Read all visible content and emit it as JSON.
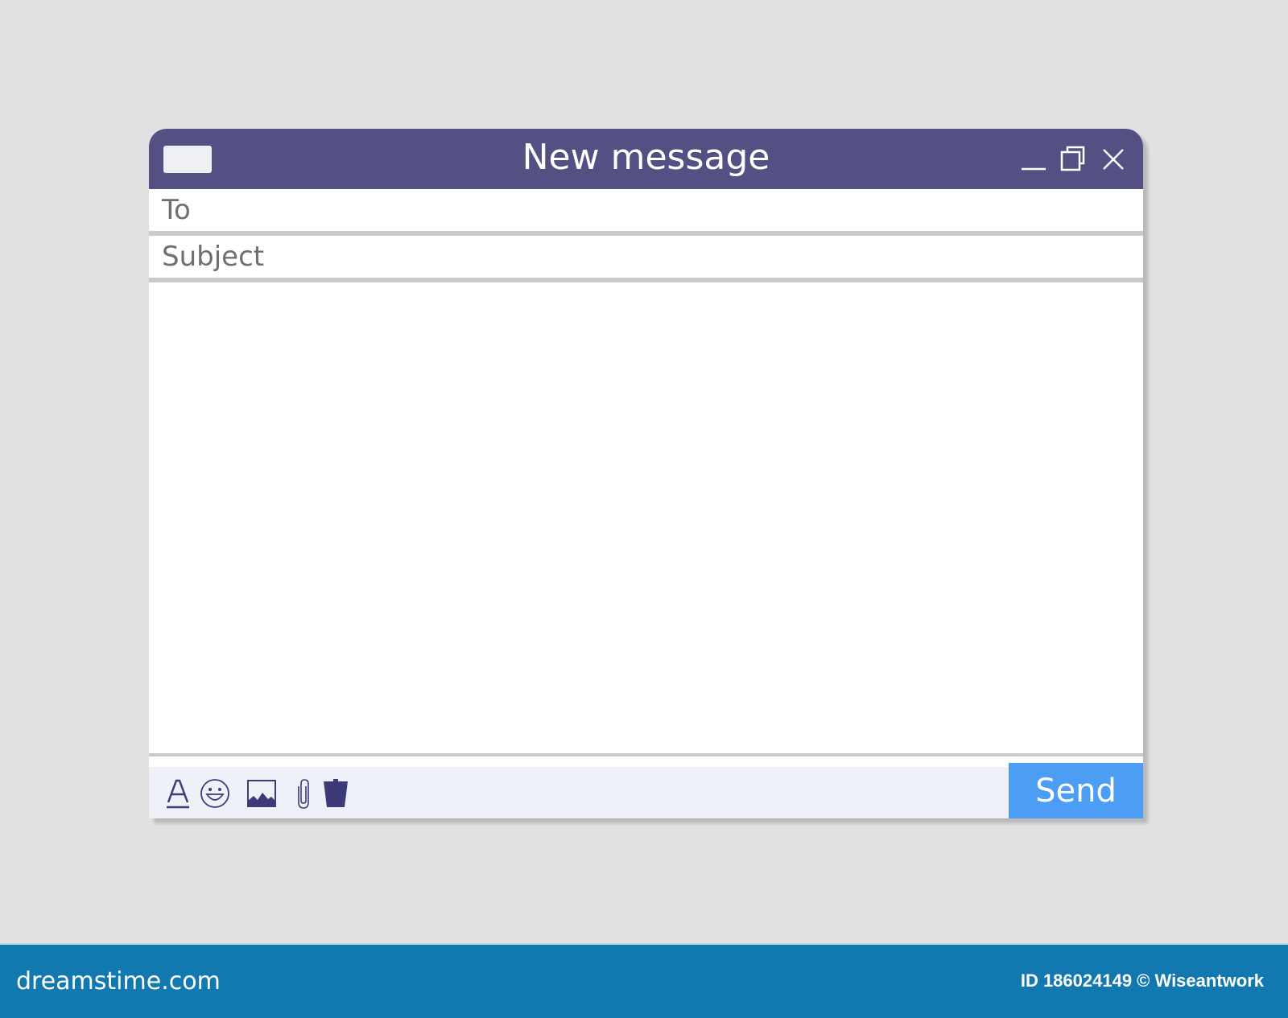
{
  "window": {
    "title": "New message",
    "icons": {
      "app": "envelope-icon",
      "minimize": "minimize-icon",
      "maximize": "restore-icon",
      "close": "close-icon"
    }
  },
  "compose": {
    "to": {
      "placeholder": "To",
      "value": ""
    },
    "subject": {
      "placeholder": "Subject",
      "value": ""
    },
    "body": {
      "value": ""
    }
  },
  "toolbar": {
    "tools": [
      {
        "name": "format-text",
        "icon": "text-format-icon"
      },
      {
        "name": "emoji",
        "icon": "smiley-icon"
      },
      {
        "name": "insert-image",
        "icon": "image-icon"
      },
      {
        "name": "attach",
        "icon": "paperclip-icon"
      },
      {
        "name": "delete",
        "icon": "trash-icon"
      }
    ],
    "send_label": "Send"
  },
  "footer": {
    "brand": "dreamstime.com",
    "credit": "ID 186024149 © Wiseantwork"
  },
  "colors": {
    "titlebar": "#545084",
    "send": "#4b9ef4",
    "toolbar_bg": "#eef1f8",
    "icon": "#3d3a78",
    "footer": "#1278b0",
    "background": "#e1e1e1"
  }
}
